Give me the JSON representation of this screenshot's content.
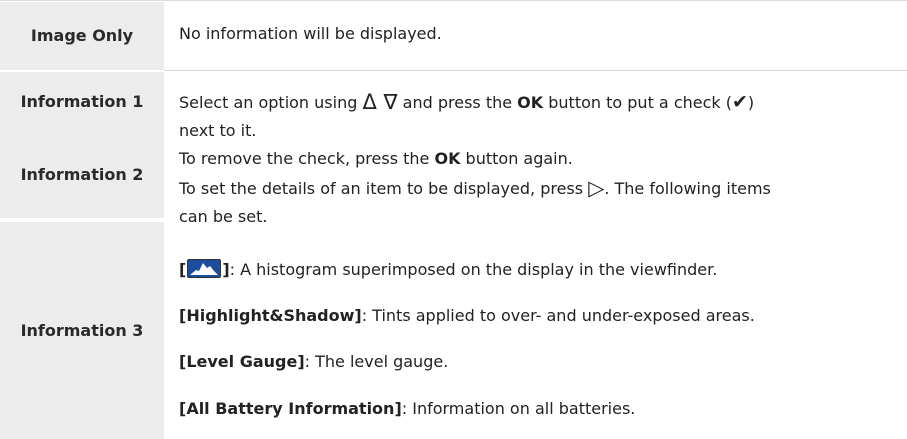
{
  "rows": [
    {
      "label": "Image Only",
      "description": "No information will be displayed."
    },
    {
      "label": "Information 1"
    },
    {
      "label": "Information 2"
    },
    {
      "label": "Information 3"
    }
  ],
  "shared_description": {
    "select_pre": "Select an option using ",
    "select_arrows": "Δ ∇",
    "select_mid": " and press the ",
    "ok": "OK",
    "select_post": " button to put a check (",
    "check_glyph": "✔",
    "select_end": ")",
    "select_line2": "next to it.",
    "remove_pre": "To remove the check, press the ",
    "remove_post": " button again.",
    "details_pre": "To set the details of an item to be displayed, press ",
    "details_arrow": "▷",
    "details_post": ". The following items",
    "details_line2": "can be set."
  },
  "items": [
    {
      "open": "[",
      "icon": "histogram-icon",
      "close": "]",
      "text": ": A histogram superimposed on the display in the viewfinder."
    },
    {
      "name": "[Highlight&Shadow]",
      "text": ": Tints applied to over- and under-exposed areas."
    },
    {
      "name": "[Level Gauge]",
      "text": ": The level gauge."
    },
    {
      "name": "[All Battery Information]",
      "text": ": Information on all batteries."
    }
  ]
}
